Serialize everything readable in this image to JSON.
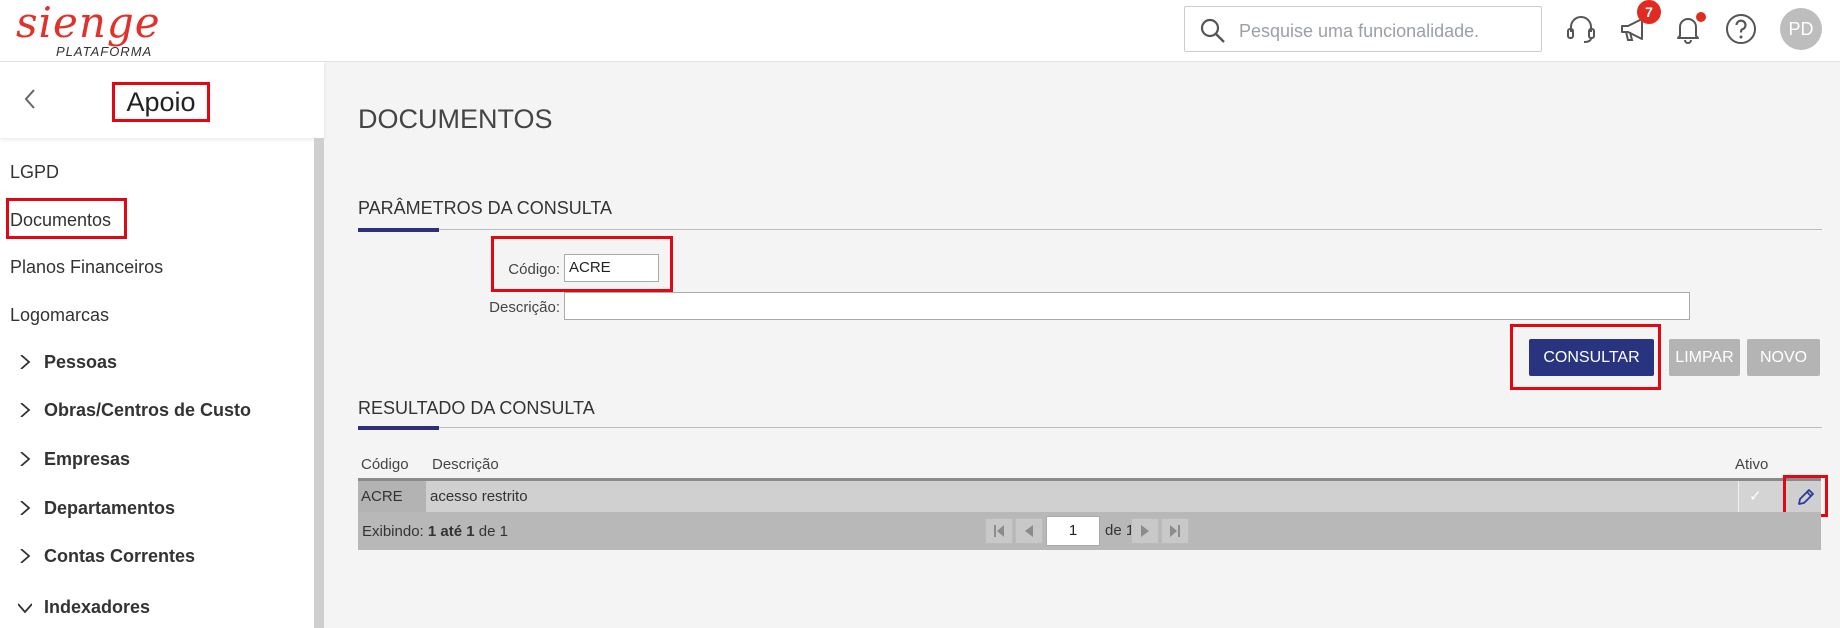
{
  "brand": {
    "name": "sienge",
    "subtitle": "PLATAFORMA",
    "color": "#e0322b"
  },
  "header": {
    "search_placeholder": "Pesquise uma funcionalidade.",
    "notifications_count": "7",
    "avatar_initials": "PD",
    "icons": [
      "search-icon",
      "headset-icon",
      "megaphone-icon",
      "bell-icon",
      "help-icon"
    ]
  },
  "sidebar": {
    "title": "Apoio",
    "items": [
      {
        "label": "LGPD"
      },
      {
        "label": "Documentos"
      },
      {
        "label": "Planos Financeiros"
      },
      {
        "label": "Logomarcas"
      }
    ],
    "groups": [
      {
        "label": "Pessoas",
        "expanded": false
      },
      {
        "label": "Obras/Centros de Custo",
        "expanded": false
      },
      {
        "label": "Empresas",
        "expanded": false
      },
      {
        "label": "Departamentos",
        "expanded": false
      },
      {
        "label": "Contas Correntes",
        "expanded": false
      },
      {
        "label": "Indexadores",
        "expanded": true
      }
    ]
  },
  "main": {
    "page_title": "DOCUMENTOS",
    "params_title": "PARÂMETROS DA CONSULTA",
    "codigo_label": "Código:",
    "codigo_value": "ACRE",
    "descricao_label": "Descrição:",
    "descricao_value": "",
    "buttons": {
      "consultar": "CONSULTAR",
      "limpar": "LIMPAR",
      "novo": "NOVO"
    },
    "results_title": "RESULTADO DA CONSULTA",
    "table": {
      "headers": {
        "codigo": "Código",
        "descricao": "Descrição",
        "ativo": "Ativo"
      },
      "rows": [
        {
          "codigo": "ACRE",
          "descricao": "acesso restrito",
          "ativo": "✓"
        }
      ]
    },
    "pager": {
      "exibindo": "Exibindo:",
      "range": "1 até 1",
      "de_label": "de",
      "total": "1",
      "page": "1",
      "of_pages": "de 1"
    }
  },
  "colors": {
    "primary_button": "#293481",
    "highlight": "#e30613",
    "accent": "#2e2e7a"
  }
}
